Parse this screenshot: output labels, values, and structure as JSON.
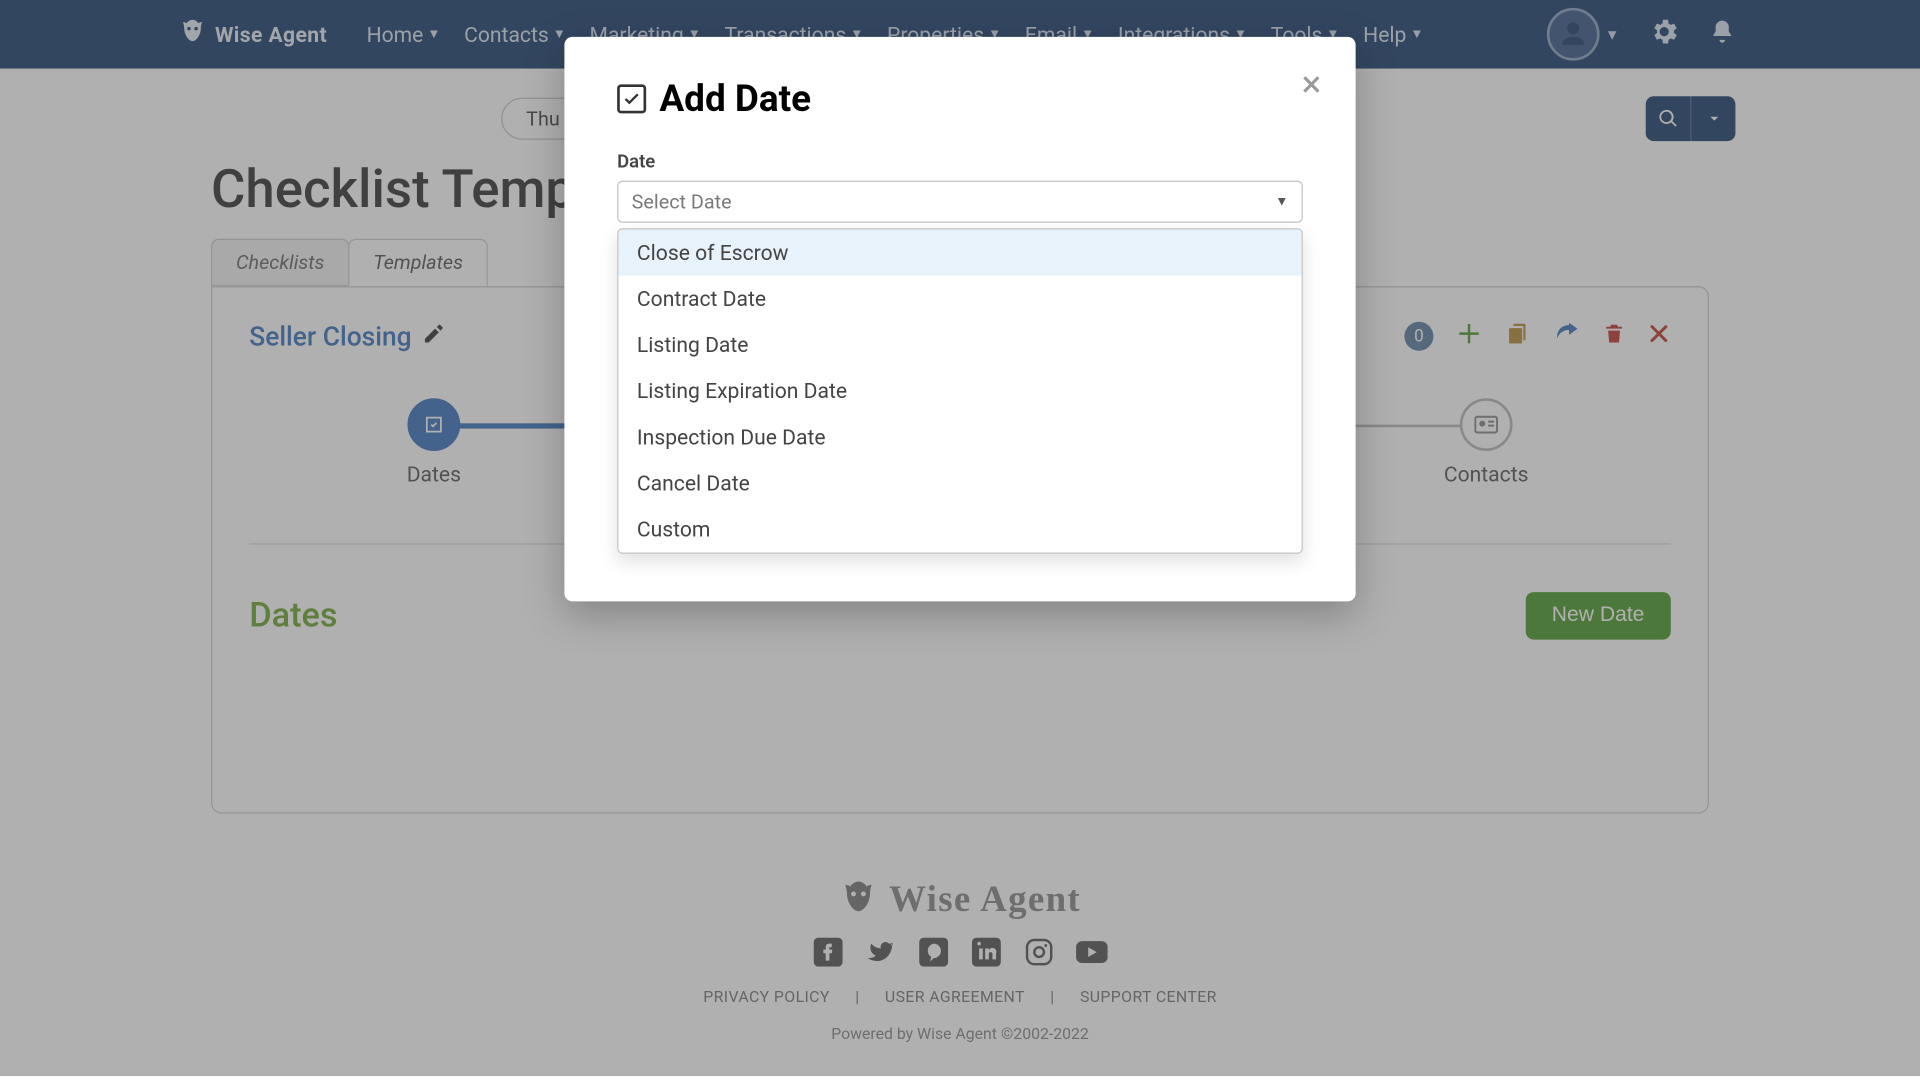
{
  "nav": {
    "brand": "Wise Agent",
    "items": [
      "Home",
      "Contacts",
      "Marketing",
      "Transactions",
      "Properties",
      "Email",
      "Integrations",
      "Tools",
      "Help"
    ]
  },
  "subbar": {
    "date_display": "Thu Feb"
  },
  "page": {
    "title": "Checklist Templates",
    "tabs": {
      "checklists": "Checklists",
      "templates": "Templates"
    },
    "template_name": "Seller Closing",
    "badge_count": "0",
    "steps": {
      "dates": "Dates",
      "contacts": "Contacts"
    },
    "section_dates_title": "Dates",
    "new_date_button": "New Date"
  },
  "modal": {
    "title": "Add Date",
    "field_label": "Date",
    "placeholder": "Select Date",
    "options": [
      "Close of Escrow",
      "Contract Date",
      "Listing Date",
      "Listing Expiration Date",
      "Inspection Due Date",
      "Cancel Date",
      "Custom"
    ]
  },
  "footer": {
    "brand": "Wise Agent",
    "legal": {
      "privacy": "PRIVACY POLICY",
      "agreement": "USER AGREEMENT",
      "support": "SUPPORT CENTER"
    },
    "powered": "Powered by Wise Agent ©2002-2022"
  }
}
